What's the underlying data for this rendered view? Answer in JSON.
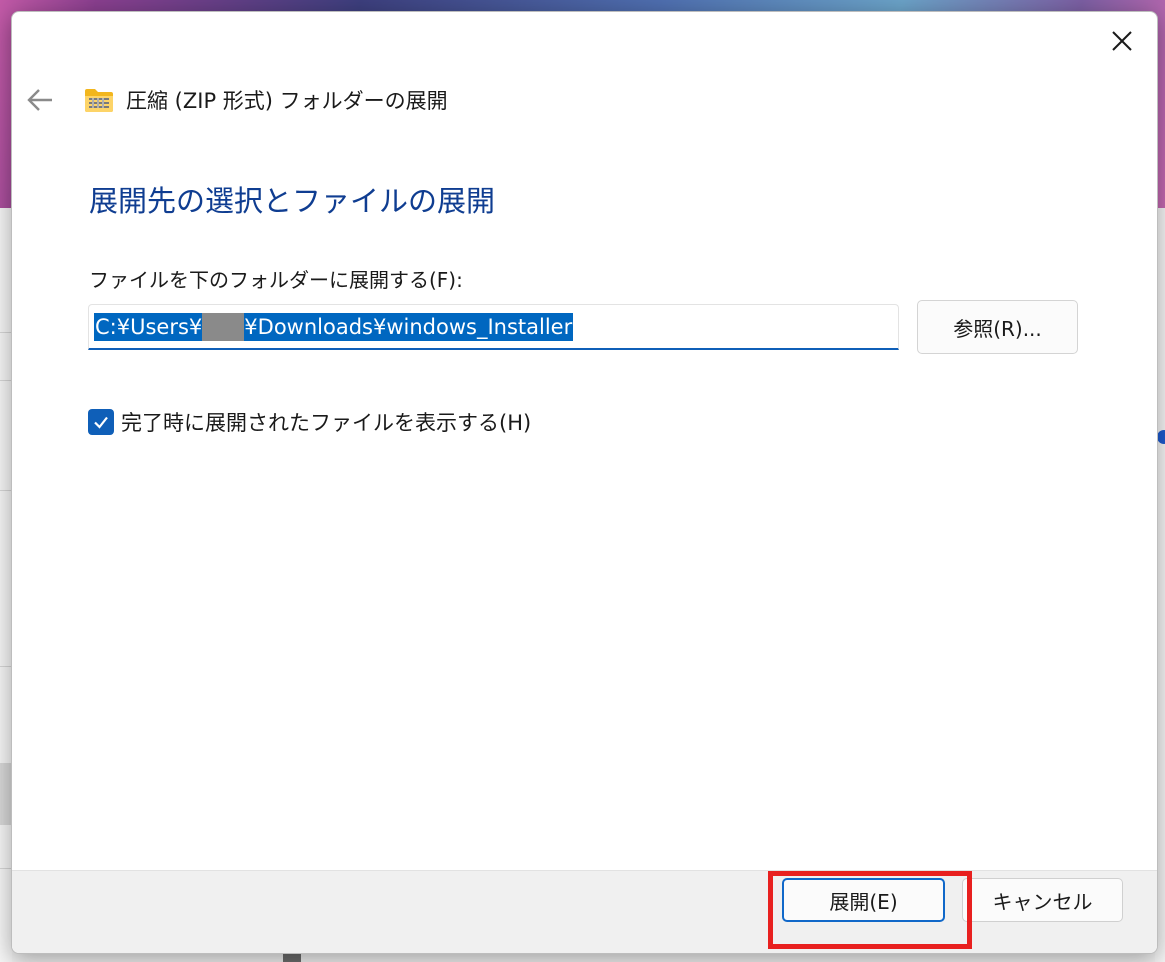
{
  "dialog": {
    "title": "圧縮 (ZIP 形式) フォルダーの展開",
    "heading": "展開先の選択とファイルの展開",
    "destination_label": "ファイルを下のフォルダーに展開する(F):",
    "path_prefix": "C:¥Users¥",
    "path_suffix": "¥Downloads¥windows_Installer",
    "browse_label": "参照(R)...",
    "checkbox_label": "完了時に展開されたファイルを表示する(H)",
    "checkbox_checked": true,
    "extract_label": "展開(E)",
    "cancel_label": "キャンセル"
  },
  "icons": {
    "close": "close-icon",
    "back": "back-arrow-icon",
    "zip": "zip-folder-icon",
    "check": "checkmark-icon"
  },
  "colors": {
    "heading": "#0f3d91",
    "accent": "#0f5fb8",
    "selection": "#0067c0",
    "highlight": "#e8201f"
  }
}
